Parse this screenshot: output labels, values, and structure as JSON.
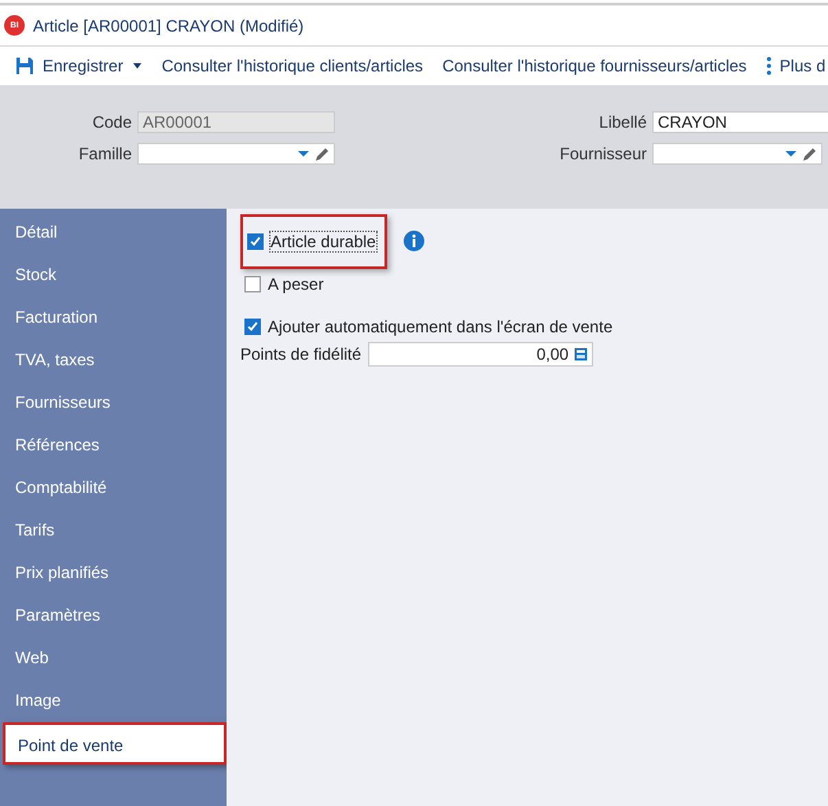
{
  "window": {
    "title": "Article [AR00001] CRAYON (Modifié)",
    "app_badge": "BI"
  },
  "toolbar": {
    "items": [
      {
        "kind": "save",
        "label": "Enregistrer"
      },
      {
        "kind": "link",
        "label": "Consulter l'historique clients/articles"
      },
      {
        "kind": "link",
        "label": "Consulter l'historique fournisseurs/articles"
      },
      {
        "kind": "more",
        "label": "Plus d"
      }
    ]
  },
  "header": {
    "fields": [
      {
        "label": "Code",
        "value": "AR00001",
        "disabled": true,
        "kind": "text"
      },
      {
        "label": "Libellé",
        "value": "CRAYON",
        "disabled": false,
        "kind": "text"
      },
      {
        "label": "Famille",
        "kind": "combo",
        "disabled": false
      },
      {
        "label": "Fournisseur",
        "kind": "combo",
        "disabled": false
      }
    ]
  },
  "sidebar": {
    "items": [
      {
        "label": "Détail",
        "selected": false,
        "highlighted": false
      },
      {
        "label": "Stock",
        "selected": false,
        "highlighted": false
      },
      {
        "label": "Facturation",
        "selected": false,
        "highlighted": false
      },
      {
        "label": "TVA, taxes",
        "selected": false,
        "highlighted": false
      },
      {
        "label": "Fournisseurs",
        "selected": false,
        "highlighted": false
      },
      {
        "label": "Références",
        "selected": false,
        "highlighted": false
      },
      {
        "label": "Comptabilité",
        "selected": false,
        "highlighted": false
      },
      {
        "label": "Tarifs",
        "selected": false,
        "highlighted": false
      },
      {
        "label": "Prix planifiés",
        "selected": false,
        "highlighted": false
      },
      {
        "label": "Paramètres",
        "selected": false,
        "highlighted": false
      },
      {
        "label": "Web",
        "selected": false,
        "highlighted": false
      },
      {
        "label": "Image",
        "selected": false,
        "highlighted": false
      },
      {
        "label": "Point de vente",
        "selected": true,
        "highlighted": true
      }
    ]
  },
  "options": [
    {
      "label": "Article durable",
      "checked": true,
      "highlighted": true,
      "kind": "checkbox_info"
    },
    {
      "label": "A peser",
      "checked": false,
      "highlighted": false,
      "kind": "checkbox"
    },
    {
      "label": "Ajouter automatiquement dans l'écran de vente",
      "checked": true,
      "highlighted": false,
      "kind": "checkbox"
    }
  ],
  "loyalty": {
    "label": "Points de fidélité",
    "value": "0,00"
  }
}
